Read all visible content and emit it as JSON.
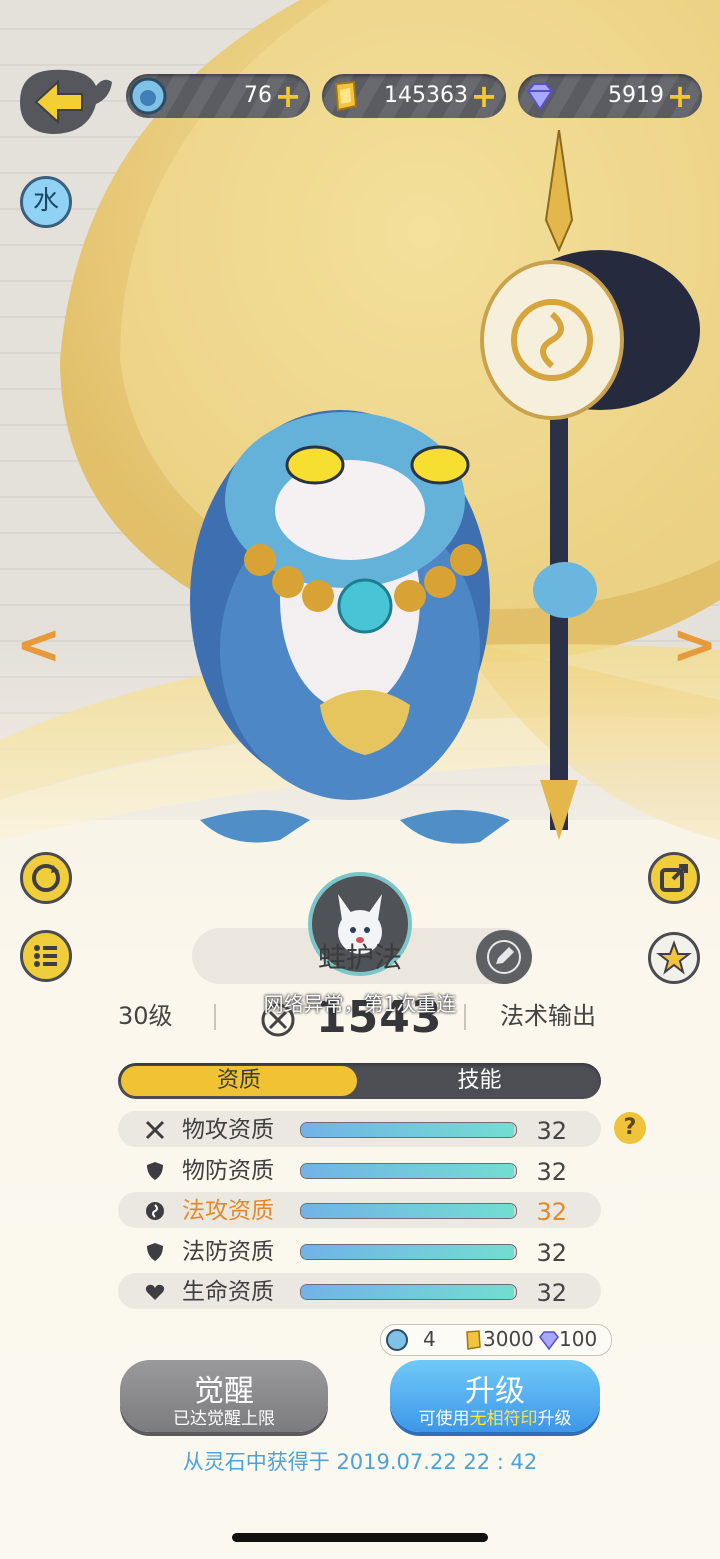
{
  "resources": [
    {
      "name": "spirit-stone",
      "value": "76"
    },
    {
      "name": "gold",
      "value": "145363"
    },
    {
      "name": "diamond",
      "value": "5919"
    }
  ],
  "element_badge": "水",
  "pet": {
    "name": "蛙护法",
    "level": "30级",
    "power": "1543",
    "role": "法术输出"
  },
  "toast": "网络异常，第1次重连",
  "tabs": {
    "aptitude": "资质",
    "skills": "技能"
  },
  "attributes": [
    {
      "icon": "crossed-swords-icon",
      "label": "物攻资质",
      "value": "32",
      "fraction": 0.99
    },
    {
      "icon": "shield-icon",
      "label": "物防资质",
      "value": "32",
      "fraction": 0.99
    },
    {
      "icon": "magic-swirl-icon",
      "label": "法攻资质",
      "value": "32",
      "fraction": 0.99
    },
    {
      "icon": "shield-icon",
      "label": "法防资质",
      "value": "32",
      "fraction": 0.99
    },
    {
      "icon": "heart-icon",
      "label": "生命资质",
      "value": "32",
      "fraction": 0.99
    }
  ],
  "cost": {
    "stone": "4",
    "gold": "3000",
    "diamond": "100"
  },
  "awaken": {
    "title": "觉醒",
    "subtitle": "已达觉醒上限"
  },
  "upgrade": {
    "title": "升级",
    "sub_prefix": "可使用",
    "sub_highlight": "无相符印",
    "sub_suffix": "升级"
  },
  "obtained": "从灵石中获得于 2019.07.22   22 : 42",
  "colors": {
    "accent_gold": "#f1c233",
    "highlight_orange": "#e2892a",
    "upgrade_blue": "#3d97e8",
    "obtain_blue": "#4ca2dc"
  }
}
